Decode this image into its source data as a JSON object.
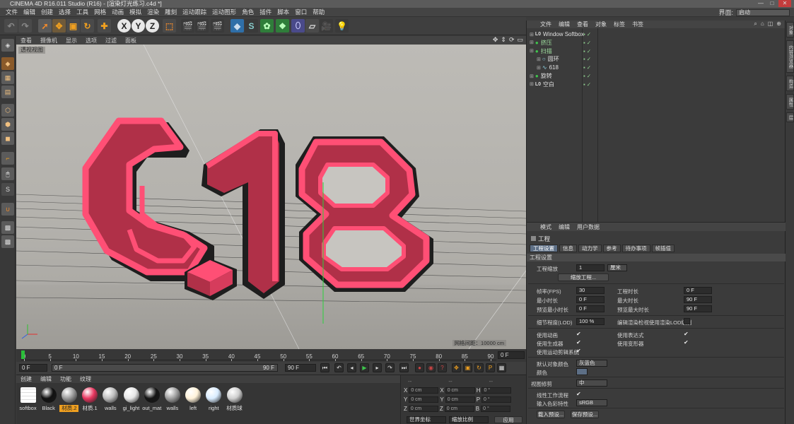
{
  "window": {
    "title": "CINEMA 4D R16.011 Studio (R16) - [渲染灯光练习.c4d *]",
    "controls": [
      "—",
      "□",
      "✕"
    ]
  },
  "menubar": {
    "items": [
      "文件",
      "编辑",
      "创建",
      "选择",
      "工具",
      "网格",
      "动画",
      "模拟",
      "渲染",
      "雕刻",
      "运动跟踪",
      "运动图形",
      "角色",
      "插件",
      "脚本",
      "窗口",
      "帮助"
    ],
    "layout_label": "界面:",
    "layout_value": "启动"
  },
  "toolbar": {
    "xyz": [
      "X",
      "Y",
      "Z"
    ]
  },
  "viewport": {
    "menus": [
      "查看",
      "摄像机",
      "显示",
      "选项",
      "过滤",
      "面板"
    ],
    "label": "透视视图",
    "grid_info": "网格间距：10000 cm",
    "scene_text": "618"
  },
  "timeline": {
    "ticks": [
      "0",
      "5",
      "10",
      "15",
      "20",
      "25",
      "30",
      "35",
      "40",
      "45",
      "50",
      "55",
      "60",
      "65",
      "70",
      "75",
      "80",
      "85",
      "90"
    ],
    "frame_display": "0 F"
  },
  "transport": {
    "start": "0 F",
    "range_start": "0 F",
    "range_end": "90 F",
    "end": "90 F"
  },
  "materials": {
    "menu": [
      "创建",
      "编辑",
      "功能",
      "纹理"
    ],
    "items": [
      {
        "name": "softbox",
        "color": "#f2f2f2"
      },
      {
        "name": "Black",
        "color": "#111111"
      },
      {
        "name": "材质.2",
        "color": "#9a9a9a"
      },
      {
        "name": "材质.1",
        "color": "#e8365f"
      },
      {
        "name": "walls",
        "color": "#bdbdbd"
      },
      {
        "name": "gi_light",
        "color": "#e6e6e6"
      },
      {
        "name": "out_mat",
        "color": "#141414"
      },
      {
        "name": "walls",
        "color": "#9e9e9e"
      },
      {
        "name": "left",
        "color": "#fff2d9"
      },
      {
        "name": "right",
        "color": "#d9ecff"
      },
      {
        "name": "材质球",
        "color": "#cfcfcf"
      }
    ]
  },
  "coords": {
    "headers": [
      "--",
      "--",
      "--"
    ],
    "rows": [
      {
        "a": "X",
        "av": "0 cm",
        "b": "X",
        "bv": "0 cm",
        "c": "H",
        "cv": "0 °"
      },
      {
        "a": "Y",
        "av": "0 cm",
        "b": "Y",
        "bv": "0 cm",
        "c": "P",
        "cv": "0 °"
      },
      {
        "a": "Z",
        "av": "0 cm",
        "b": "Z",
        "bv": "0 cm",
        "c": "B",
        "cv": "0 °"
      }
    ],
    "mode1": "世界坐标",
    "mode2": "缩放比例",
    "apply": "应用"
  },
  "objects": {
    "menu": [
      "文件",
      "编辑",
      "查看",
      "对象",
      "标签",
      "书签"
    ],
    "items": [
      {
        "name": "Window Softbox",
        "icon": "L0"
      },
      {
        "name": "挤压",
        "icon": "green"
      },
      {
        "name": "扫描",
        "icon": "green"
      },
      {
        "name": "圆环",
        "icon": "circle"
      },
      {
        "name": "618",
        "icon": "spline"
      },
      {
        "name": "旋转",
        "icon": "green"
      },
      {
        "name": "空白",
        "icon": "L0"
      }
    ]
  },
  "attributes": {
    "menu": [
      "模式",
      "编辑",
      "用户数据"
    ],
    "title": "工程",
    "tabs": [
      "工程设置",
      "信息",
      "动力学",
      "参考",
      "待办事项",
      "帧插值"
    ],
    "section": "工程设置",
    "scale_label": "工程缩放",
    "scale_value": "1",
    "scale_unit": "厘米",
    "scale_button": "缩放工程...",
    "fps_label": "帧率(FPS)",
    "fps_value": "30",
    "min_label": "最小时长",
    "min_value": "0 F",
    "pmin_label": "预览最小时长",
    "pmin_value": "0 F",
    "dur_label": "工程时长",
    "dur_value": "0 F",
    "max_label": "最大时长",
    "max_value": "90 F",
    "pmax_label": "预览最大时长",
    "pmax_value": "90 F",
    "lod_label": "细节程度(LOD)",
    "lod_value": "100 %",
    "lod_render_label": "编辑渲染检视使用渲染LOD级别",
    "use_anim": "使用动画",
    "use_expr": "使用表达式",
    "use_gen": "使用生成器",
    "use_deform": "使用变形器",
    "use_motion": "使用运动剪辑系统",
    "def_color_label": "默认对象颜色",
    "def_color_value": "灰蓝色",
    "color_label": "颜色",
    "view_clip_label": "视图修剪",
    "view_clip_value": "中",
    "linear_label": "线性工作流程",
    "input_color_label": "输入色彩特性",
    "input_color_value": "sRGB",
    "load_btn": "载入预设...",
    "save_btn": "保存预设..."
  },
  "sidetabs": [
    "对象",
    "内容浏览器",
    "构造",
    "属性",
    "层"
  ]
}
